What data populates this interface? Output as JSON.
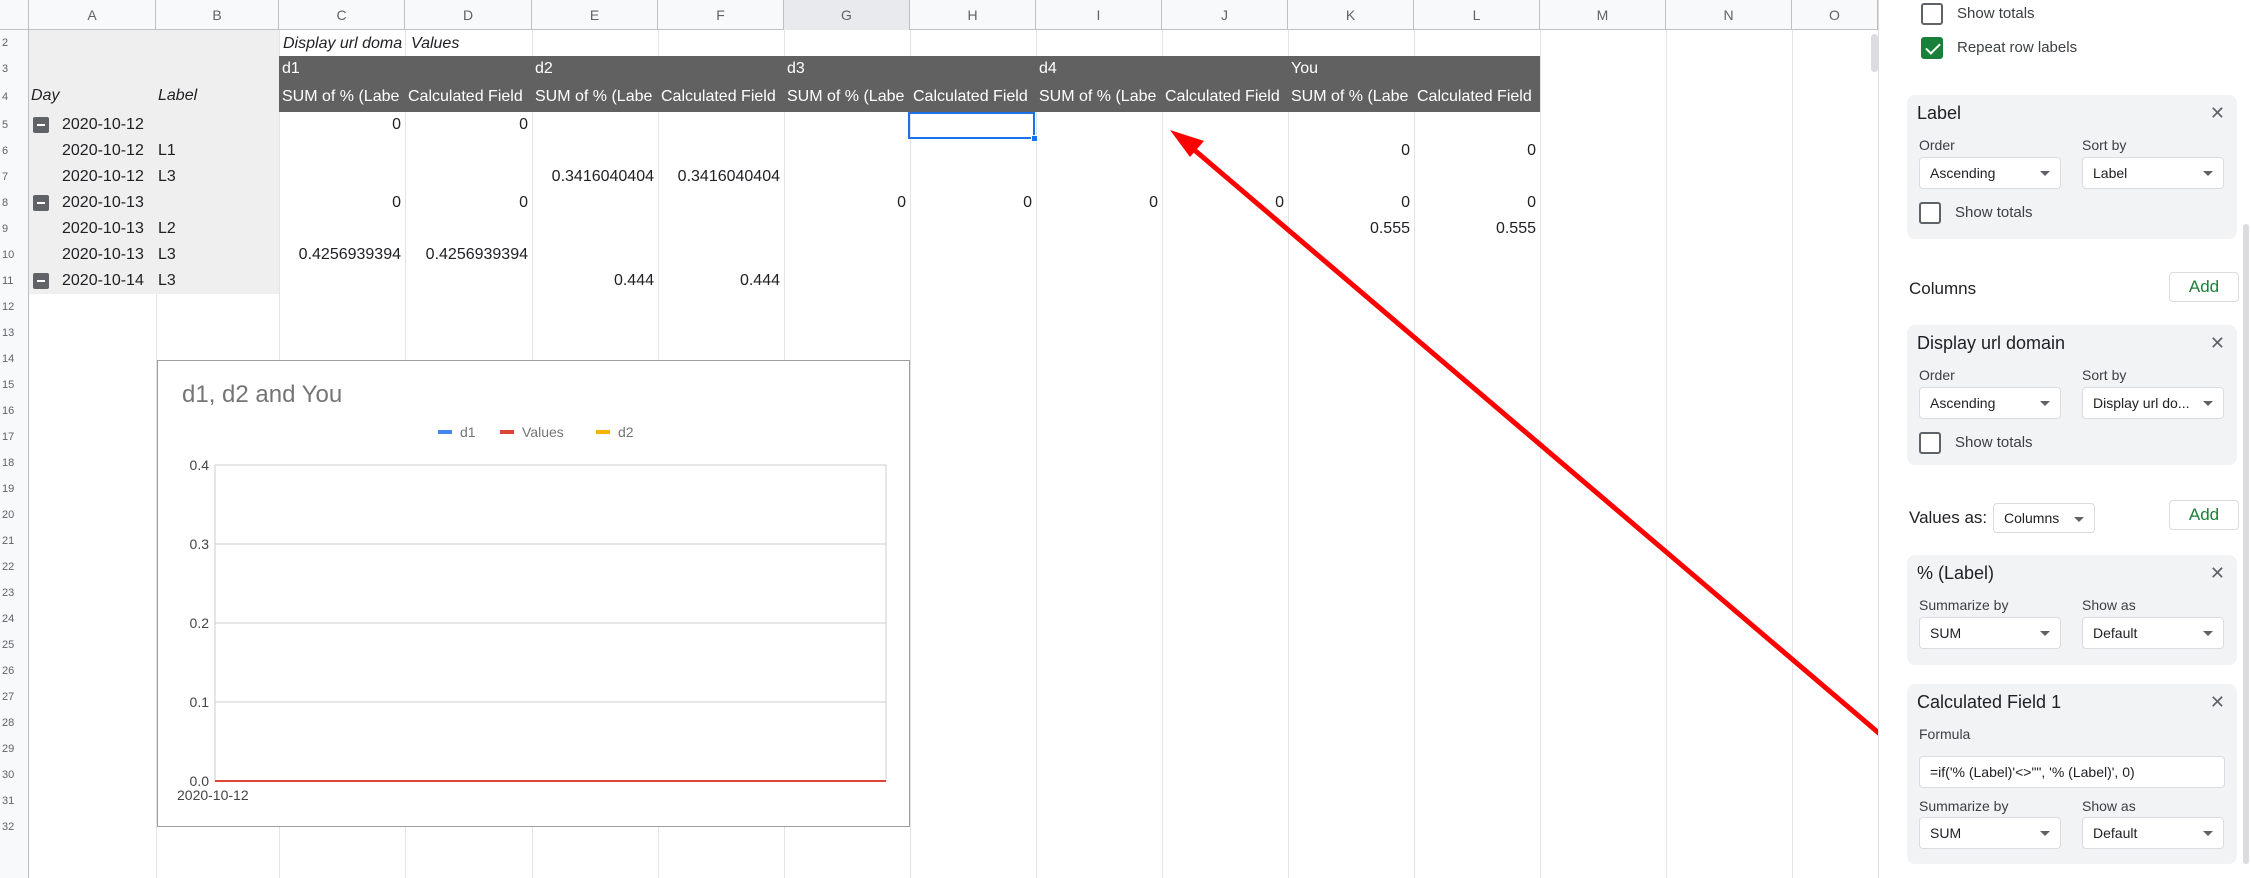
{
  "sheet": {
    "columns": [
      "A",
      "B",
      "C",
      "D",
      "E",
      "F",
      "G",
      "H",
      "I",
      "J",
      "K",
      "L",
      "M",
      "N",
      "O"
    ],
    "row_numbers": [
      "2",
      "3",
      "4",
      "5",
      "6",
      "7",
      "8",
      "9",
      "10",
      "11",
      "12",
      "13",
      "14",
      "15",
      "16",
      "17",
      "18",
      "19",
      "20",
      "21",
      "22",
      "23",
      "24",
      "25",
      "26",
      "27",
      "28",
      "29",
      "30",
      "31",
      "32"
    ],
    "pivot": {
      "header_display": "Display url doma",
      "header_values": "Values",
      "groups": [
        "d1",
        "d2",
        "d3",
        "d4",
        "You"
      ],
      "label_day": "Day",
      "label_label": "Label",
      "subheaders": [
        "SUM of % (Labe",
        "Calculated Field",
        "SUM of % (Labe",
        "Calculated Field",
        "SUM of % (Labe",
        "Calculated Field",
        "SUM of % (Labe",
        "Calculated Field",
        "SUM of % (Labe",
        "Calculated Field"
      ],
      "rows": [
        {
          "day": "2020-10-12",
          "label": "",
          "values": [
            "0",
            "0",
            "",
            "",
            "",
            "",
            "",
            "",
            "",
            ""
          ]
        },
        {
          "day": "2020-10-12",
          "label": "L1",
          "values": [
            "",
            "",
            "",
            "",
            "",
            "",
            "",
            "",
            "0",
            "0"
          ]
        },
        {
          "day": "2020-10-12",
          "label": "L3",
          "values": [
            "",
            "",
            "0.3416040404",
            "0.3416040404",
            "",
            "",
            "",
            "",
            "",
            ""
          ]
        },
        {
          "day": "2020-10-13",
          "label": "",
          "values": [
            "0",
            "0",
            "",
            "",
            "0",
            "0",
            "0",
            "0",
            "0",
            "0"
          ]
        },
        {
          "day": "2020-10-13",
          "label": "L2",
          "values": [
            "",
            "",
            "",
            "",
            "",
            "",
            "",
            "",
            "0.555",
            "0.555"
          ]
        },
        {
          "day": "2020-10-13",
          "label": "L3",
          "values": [
            "0.4256939394",
            "0.4256939394",
            "",
            "",
            "",
            "",
            "",
            "",
            "",
            ""
          ]
        },
        {
          "day": "2020-10-14",
          "label": "L3",
          "values": [
            "",
            "",
            "0.444",
            "0.444",
            "",
            "",
            "",
            "",
            "",
            ""
          ]
        }
      ]
    }
  },
  "chart_data": {
    "type": "line",
    "title": "d1, d2 and You",
    "x": [
      "2020-10-12"
    ],
    "series": [
      {
        "name": "d1",
        "color": "#4285f4",
        "values": [
          0
        ]
      },
      {
        "name": "Values",
        "color": "#db4437",
        "values": [
          0
        ]
      },
      {
        "name": "d2",
        "color": "#f4b400",
        "values": [
          0
        ]
      }
    ],
    "ylim": [
      0,
      0.4
    ],
    "yticks": [
      "0.4",
      "0.3",
      "0.2",
      "0.1",
      "0.0"
    ],
    "legend_position": "top",
    "grid": true
  },
  "panel": {
    "show_totals": "Show totals",
    "repeat_row_labels": "Repeat row labels",
    "label_card": {
      "title": "Label",
      "order_label": "Order",
      "order_value": "Ascending",
      "sortby_label": "Sort by",
      "sortby_value": "Label",
      "show_totals": "Show totals"
    },
    "columns_section": "Columns",
    "add": "Add",
    "display_card": {
      "title": "Display url domain",
      "order_label": "Order",
      "order_value": "Ascending",
      "sortby_label": "Sort by",
      "sortby_value": "Display url do...",
      "show_totals": "Show totals"
    },
    "values_as": "Values as:",
    "values_as_value": "Columns",
    "pct_card": {
      "title": "% (Label)",
      "summarize_label": "Summarize by",
      "summarize_value": "SUM",
      "showas_label": "Show as",
      "showas_value": "Default"
    },
    "calc_card": {
      "title": "Calculated Field 1",
      "formula_label": "Formula",
      "formula_value": "=if('% (Label)'<>\"\", '% (Label)', 0)",
      "summarize_label": "Summarize by",
      "summarize_value": "SUM",
      "showas_label": "Show as",
      "showas_value": "Default"
    }
  }
}
